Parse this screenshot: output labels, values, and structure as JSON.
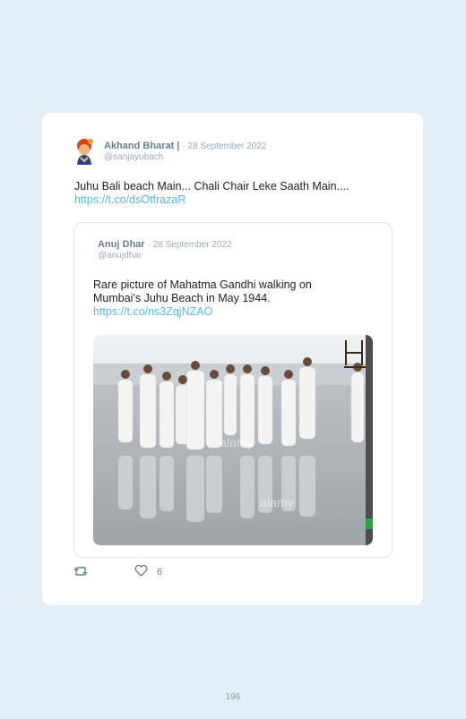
{
  "tweet": {
    "author_name": "Akhand Bharat |",
    "date": "· 28 September 2022",
    "handle": "@sanjayubach",
    "text": "Juhu Bali beach Main... Chali Chair Leke Saath Main....",
    "link": "https://t.co/dsOtfrazaR"
  },
  "quote": {
    "author_name": "Anuj Dhar",
    "date": "· 28 September 2022",
    "handle": "@anujdhar",
    "text": "Rare picture of Mahatma Gandhi walking on Mumbai's Juhu Beach in May 1944.",
    "link": "https://t.co/ns3ZqjNZAO",
    "watermark": "alamy"
  },
  "actions": {
    "retweet_icon": "retweet-icon",
    "like_icon": "heart-icon",
    "like_count": "6"
  },
  "page_number": "196"
}
